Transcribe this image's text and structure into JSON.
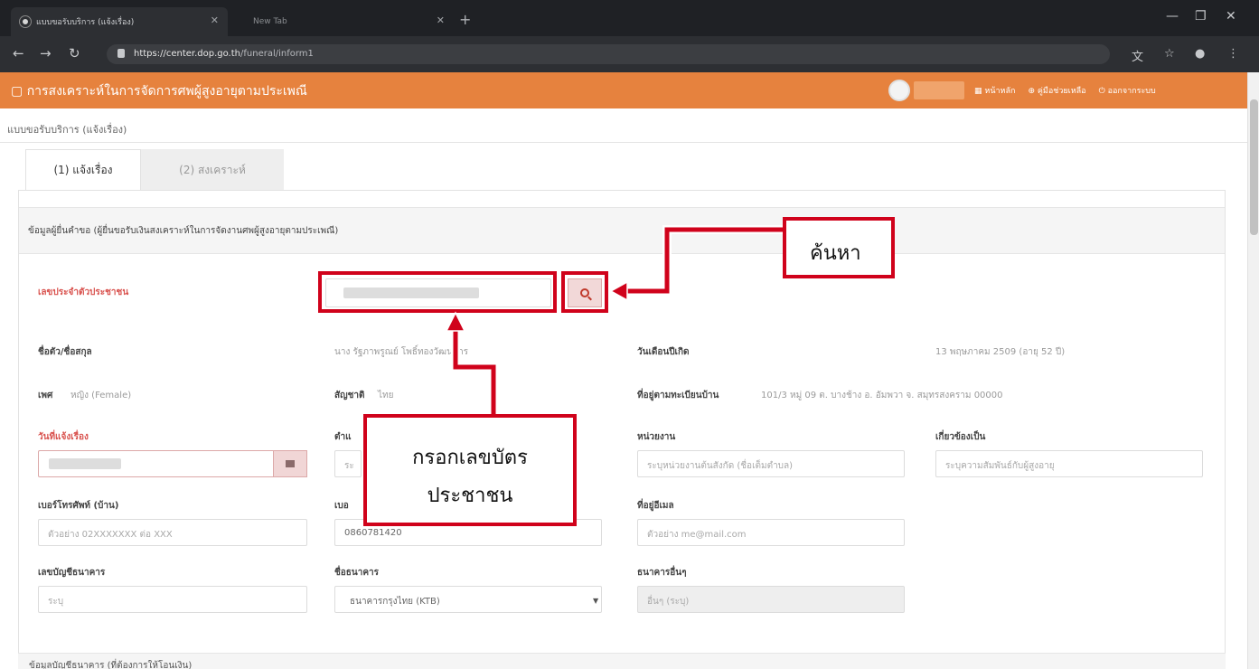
{
  "browser": {
    "tabs": [
      {
        "title": "แบบขอรับบริการ (แจ้งเรื่อง)"
      },
      {
        "title": "New Tab"
      }
    ],
    "url_host": "https://center.dop.go.th",
    "url_path": "/funeral/inform1"
  },
  "app": {
    "title": "การสงเคราะห์ในการจัดการศพผู้สูงอายุตามประเพณี",
    "header_links": [
      "หน้าหลัก",
      "คู่มือช่วยเหลือ",
      "ออกจากระบบ"
    ]
  },
  "breadcrumb": "แบบขอรับบริการ (แจ้งเรื่อง)",
  "tabs": [
    {
      "label": "(1) แจ้งเรื่อง"
    },
    {
      "label": "(2) สงเคราะห์"
    }
  ],
  "section_title": "ข้อมูลผู้ยื่นคำขอ (ผู้ยื่นขอรับเงินสงเคราะห์ในการจัดงานศพผู้สูงอายุตามประเพณี)",
  "form": {
    "citizen_id_label": "เลขประจำตัวประชาชน",
    "name_label": "ชื่อตัว/ชื่อสกุล",
    "name_value": "นาง รัฐภาพรูณย์ โพธิ์ทองวัฒนากร",
    "birth_label": "วันเดือนปีเกิด",
    "birth_value": "13 พฤษภาคม 2509 (อายุ 52 ปี)",
    "gender_label": "เพศ",
    "gender_value": "หญิง (Female)",
    "nationality_label": "สัญชาติ",
    "nationality_value": "ไทย",
    "address_label": "ที่อยู่ตามทะเบียนบ้าน",
    "address_value": "101/3 หมู่ 09 ต. บางช้าง อ. อัมพวา จ. สมุทรสงคราม 00000",
    "notify_date_label": "วันที่แจ้งเรื่อง",
    "agency_label": "หน่วยงาน",
    "agency_placeholder": "ระบุหน่วยงานต้นสังกัด (ชื่อเต็มตำบล)",
    "relation_label": "เกี่ยวข้องเป็น",
    "relation_placeholder": "ระบุความสัมพันธ์กับผู้สูงอายุ",
    "phone_home_label": "เบอร์โทรศัพท์ (บ้าน)",
    "phone_home_placeholder": "ตัวอย่าง 02XXXXXXX ต่อ XXX",
    "mobile_value": "0860781420",
    "email_label": "ที่อยู่อีเมล",
    "email_placeholder": "ตัวอย่าง me@mail.com",
    "bank_account_label": "เลขบัญชีธนาคาร",
    "bank_account_placeholder": "ระบุ",
    "bank_name_label": "ชื่อธนาคาร",
    "bank_name_value": "ธนาคารกรุงไทย (KTB)",
    "other_bank_label": "ธนาคารอื่นๆ",
    "other_bank_placeholder": "อื่นๆ (ระบุ)",
    "field_label_cut_1": "ตำแ",
    "field_label_cut_2": "เบอ",
    "placeholder_cut": "ระ"
  },
  "next_section_title": "ข้อมูลบัญชีธนาคาร (ที่ต้องการให้โอนเงิน)",
  "annotations": {
    "search_callout": "ค้นหา",
    "id_callout_line1": "กรอกเลขบัตร",
    "id_callout_line2": "ประชาชน"
  },
  "colors": {
    "header_orange": "#e6823e",
    "annotation_red": "#d0021b",
    "required_label_red": "#d9534f"
  }
}
